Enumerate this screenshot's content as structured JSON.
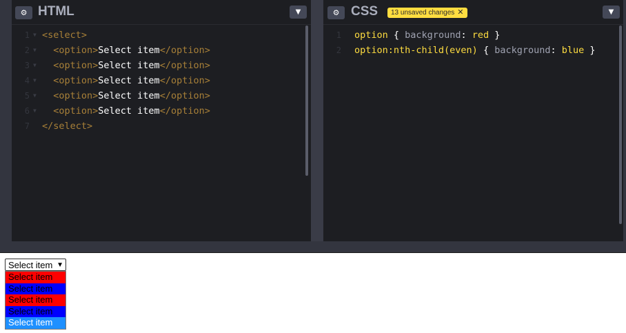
{
  "html_panel": {
    "title": "HTML",
    "lines": [
      {
        "n": "1",
        "parts": [
          {
            "c": "tag",
            "t": "<select>"
          }
        ]
      },
      {
        "n": "2",
        "parts": [
          {
            "c": "tag",
            "t": "  <option>"
          },
          {
            "c": "tx",
            "t": "Select item"
          },
          {
            "c": "tag",
            "t": "</option>"
          }
        ]
      },
      {
        "n": "3",
        "parts": [
          {
            "c": "tag",
            "t": "  <option>"
          },
          {
            "c": "tx",
            "t": "Select item"
          },
          {
            "c": "tag",
            "t": "</option>"
          }
        ]
      },
      {
        "n": "4",
        "parts": [
          {
            "c": "tag",
            "t": "  <option>"
          },
          {
            "c": "tx",
            "t": "Select item"
          },
          {
            "c": "tag",
            "t": "</option>"
          }
        ]
      },
      {
        "n": "5",
        "parts": [
          {
            "c": "tag",
            "t": "  <option>"
          },
          {
            "c": "tx",
            "t": "Select item"
          },
          {
            "c": "tag",
            "t": "</option>"
          }
        ]
      },
      {
        "n": "6",
        "parts": [
          {
            "c": "tag",
            "t": "  <option>"
          },
          {
            "c": "tx",
            "t": "Select item"
          },
          {
            "c": "tag",
            "t": "</option>"
          }
        ]
      },
      {
        "n": "7",
        "parts": [
          {
            "c": "tag",
            "t": "</select>"
          }
        ]
      }
    ]
  },
  "css_panel": {
    "title": "CSS",
    "badge": "13 unsaved changes",
    "badge_close": "✕",
    "lines": [
      {
        "n": "1",
        "parts": [
          {
            "c": "sel",
            "t": "option"
          },
          {
            "c": "pun",
            "t": " { "
          },
          {
            "c": "prop",
            "t": "background"
          },
          {
            "c": "pun",
            "t": ": "
          },
          {
            "c": "val",
            "t": "red"
          },
          {
            "c": "pun",
            "t": " }"
          }
        ]
      },
      {
        "n": "2",
        "parts": [
          {
            "c": "sel",
            "t": "option:nth-child(even)"
          },
          {
            "c": "pun",
            "t": " { "
          },
          {
            "c": "prop",
            "t": "background"
          },
          {
            "c": "pun",
            "t": ": "
          },
          {
            "c": "val",
            "t": "blue"
          },
          {
            "c": "pun",
            "t": " }"
          }
        ]
      }
    ]
  },
  "icons": {
    "settings": "gear-icon",
    "collapse": "chevron-down-icon"
  },
  "preview": {
    "selected": "Select item",
    "options": [
      {
        "label": "Select item",
        "bg": "red"
      },
      {
        "label": "Select item",
        "bg": "blue"
      },
      {
        "label": "Select item",
        "bg": "red"
      },
      {
        "label": "Select item",
        "bg": "blue"
      },
      {
        "label": "Select item",
        "bg": "highlighted"
      }
    ]
  },
  "colors": {
    "badge": "#ffdd40",
    "editor_bg": "#1d1e22",
    "option_red": "#ff0000",
    "option_blue": "#0000ff",
    "option_highlight": "#1e90ff"
  }
}
